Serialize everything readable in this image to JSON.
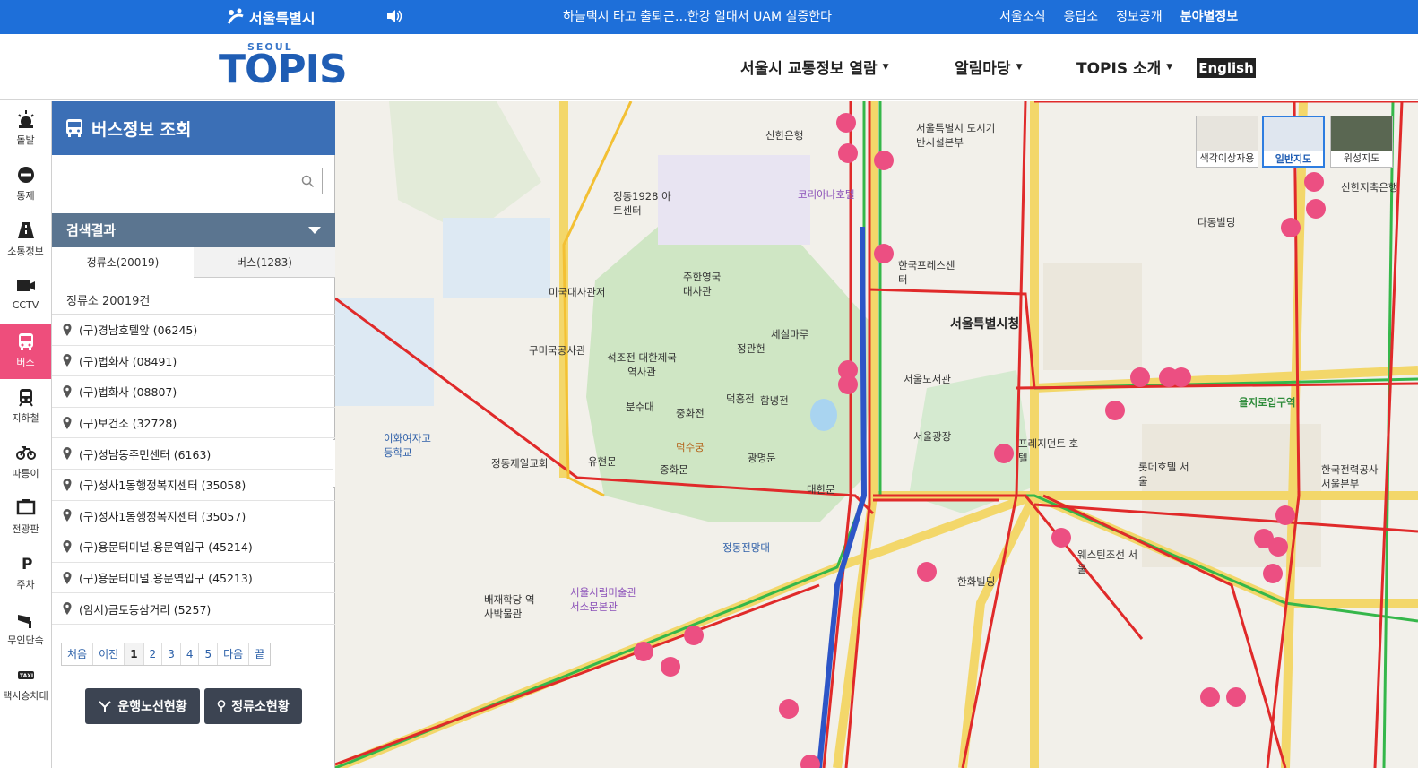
{
  "topbar": {
    "city_name": "서울특별시",
    "news": "하늘택시 타고 출퇴근…한강 일대서 UAM 실증한다",
    "links": [
      "서울소식",
      "응답소",
      "정보공개",
      "분야별정보"
    ]
  },
  "header": {
    "brand_small": "SEOUL",
    "brand_big": "TOPIS",
    "menu": [
      {
        "label": "서울시 교통정보 열람"
      },
      {
        "label": "알림마당"
      },
      {
        "label": "TOPIS 소개"
      }
    ],
    "english": "English"
  },
  "rail": [
    {
      "label": "돌발",
      "icon": "siren-icon"
    },
    {
      "label": "통제",
      "icon": "no-entry-icon"
    },
    {
      "label": "소통정보",
      "icon": "road-icon"
    },
    {
      "label": "CCTV",
      "icon": "camera-icon"
    },
    {
      "label": "버스",
      "icon": "bus-icon"
    },
    {
      "label": "지하철",
      "icon": "subway-icon"
    },
    {
      "label": "따릉이",
      "icon": "bicycle-icon"
    },
    {
      "label": "전광판",
      "icon": "sign-board-icon"
    },
    {
      "label": "주차",
      "icon": "parking-icon"
    },
    {
      "label": "무인단속",
      "icon": "speed-camera-icon"
    },
    {
      "label": "택시승차대",
      "icon": "taxi-icon"
    }
  ],
  "panel": {
    "title": "버스정보 조회",
    "search_placeholder": "",
    "results_label": "검색결과",
    "tabs": [
      "정류소(20019)",
      "버스(1283)"
    ],
    "count_text": "정류소 20019건",
    "stops": [
      "(구)경남호텔앞 (06245)",
      "(구)법화사 (08491)",
      "(구)법화사 (08807)",
      "(구)보건소 (32728)",
      "(구)성남동주민센터 (6163)",
      "(구)성사1동행정복지센터 (35058)",
      "(구)성사1동행정복지센터 (35057)",
      "(구)용문터미널.용문역입구 (45214)",
      "(구)용문터미널.용문역입구 (45213)",
      "(임시)금토동삼거리 (5257)"
    ],
    "pager": [
      "처음",
      "이전",
      "1",
      "2",
      "3",
      "4",
      "5",
      "다음",
      "끝"
    ],
    "buttons": [
      "운행노선현황",
      "정류소현황"
    ]
  },
  "map": {
    "types": [
      "색각이상자용",
      "일반지도",
      "위성지도"
    ],
    "labels": [
      {
        "t": "서울특별시청"
      },
      {
        "t": "서울광장"
      },
      {
        "t": "서울도서관"
      },
      {
        "t": "덕수궁"
      },
      {
        "t": "중화전"
      },
      {
        "t": "석조전 대한제국역사관"
      },
      {
        "t": "정동제일교회"
      },
      {
        "t": "미국대사관저"
      },
      {
        "t": "구미국공사관"
      },
      {
        "t": "정관헌"
      },
      {
        "t": "덕홍전"
      },
      {
        "t": "함녕전"
      },
      {
        "t": "대한문"
      },
      {
        "t": "광명문"
      },
      {
        "t": "중화문"
      },
      {
        "t": "분수대"
      },
      {
        "t": "유현문"
      },
      {
        "t": "을지로입구역"
      },
      {
        "t": "프레지던트 호텔"
      },
      {
        "t": "롯데호텔 서울"
      },
      {
        "t": "웨스틴조선 서울"
      },
      {
        "t": "한국프레스센터"
      },
      {
        "t": "서울시립미술관 서소문본관"
      },
      {
        "t": "이화여자고등학교"
      },
      {
        "t": "정동전망대"
      },
      {
        "t": "세실마루"
      },
      {
        "t": "주한영국대사관"
      },
      {
        "t": "한화빌딩"
      },
      {
        "t": "코리아나호텔"
      },
      {
        "t": "신한은행"
      },
      {
        "t": "서울특별시 도시기반시설본부"
      },
      {
        "t": "배재학당 역사박물관"
      },
      {
        "t": "정동1928 아트센터"
      },
      {
        "t": "다동빌딩"
      },
      {
        "t": "신한저축은행"
      },
      {
        "t": "한국전력공사 서울본부"
      }
    ]
  }
}
